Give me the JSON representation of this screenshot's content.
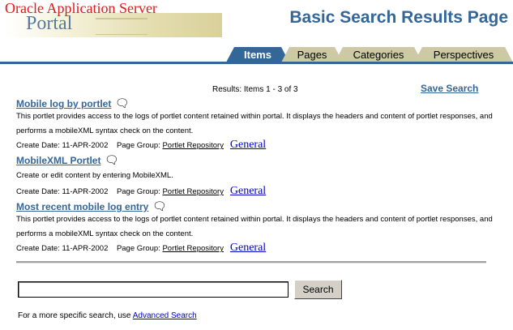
{
  "header": {
    "logo_line1": "Oracle Application Server",
    "logo_line2": "Portal",
    "page_title": "Basic Search Results Page"
  },
  "tabs": [
    {
      "label": "Items",
      "active": true
    },
    {
      "label": "Pages",
      "active": false
    },
    {
      "label": "Categories",
      "active": false
    },
    {
      "label": "Perspectives",
      "active": false
    }
  ],
  "results": {
    "count_text": "Results: Items 1 - 3 of 3",
    "save_search": "Save Search",
    "items": [
      {
        "title": "Mobile log by portlet",
        "desc": "This portlet provides access to the logs of portlet content retained within portal. It displays the headers and content of portlet responses, and performs a mobileXML syntax check on the content.",
        "create_label": "Create Date:",
        "create_date": "11-APR-2002",
        "page_group_label": "Page Group:",
        "page_group": "Portlet Repository",
        "category": "General"
      },
      {
        "title": "MobileXML Portlet",
        "desc": "Create or edit content by entering MobileXML.",
        "create_label": "Create Date:",
        "create_date": "11-APR-2002",
        "page_group_label": "Page Group:",
        "page_group": "Portlet Repository",
        "category": "General"
      },
      {
        "title": "Most recent mobile log entry",
        "desc": "This portlet provides access to the logs of portlet content retained within portal. It displays the headers and content of portlet responses, and performs a mobileXML syntax check on the content.",
        "create_label": "Create Date:",
        "create_date": "11-APR-2002",
        "page_group_label": "Page Group:",
        "page_group": "Portlet Repository",
        "category": "General"
      }
    ]
  },
  "search": {
    "value": "",
    "button_label": "Search",
    "adv_prefix": "For a more specific search, use",
    "adv_link": "Advanced Search"
  },
  "colors": {
    "accent": "#336699",
    "tab_inactive": "#ccc9a4",
    "logo_red": "#e01818"
  }
}
